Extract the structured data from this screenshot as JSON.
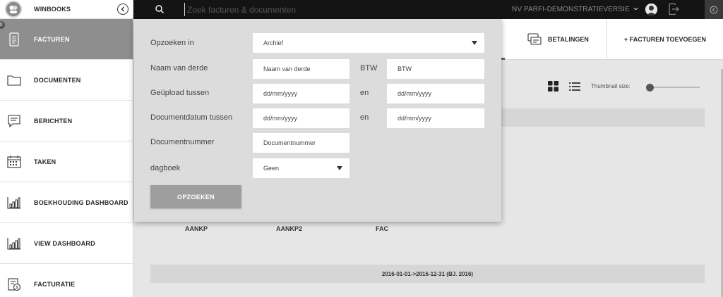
{
  "brand": {
    "name": "WINBOOKS"
  },
  "sidebar": {
    "items": [
      {
        "label": "FACTUREN",
        "icon": "document-icon",
        "active": true
      },
      {
        "label": "DOCUMENTEN",
        "icon": "folder-icon"
      },
      {
        "label": "BERICHTEN",
        "icon": "message-icon"
      },
      {
        "label": "TAKEN",
        "icon": "calendar-icon"
      },
      {
        "label": "BOEKHOUDING DASHBOARD",
        "icon": "bar-chart-icon"
      },
      {
        "label": "VIEW DASHBOARD",
        "icon": "bar-chart-icon"
      },
      {
        "label": "FACTURATIE",
        "icon": "invoice-icon"
      }
    ],
    "badge": "0"
  },
  "topbar": {
    "search_placeholder": "Zoek facturen & documenten",
    "company": "NV PARFI-DEMONSTRATIEVERSIE"
  },
  "tabs": {
    "payments": "BETALINGEN",
    "add_invoices": "+ FACTUREN TOEVOEGEN"
  },
  "view": {
    "thumbnail_label": "Thumbnail size:",
    "thumbnail_level": 0
  },
  "journals": [
    "AANKP",
    "AANKP2",
    "FAC"
  ],
  "period": "2016-01-01->2016-12-31 (BJ. 2016)",
  "search_panel": {
    "search_in_label": "Opzoeken in",
    "search_in_value": "Archief",
    "third_party_label": "Naam van derde",
    "third_party_placeholder": "Naam van derde",
    "vat_label": "BTW",
    "vat_placeholder": "BTW",
    "uploaded_label": "Geüpload tussen",
    "date_placeholder": "dd/mm/yyyy",
    "and_label": "en",
    "docdate_label": "Documentdatum tussen",
    "docnumber_label": "Documentnummer",
    "docnumber_placeholder": "Documentnummer",
    "journal_label": "dagboek",
    "journal_value": "Geen",
    "search_button": "OPZOEKEN"
  },
  "colors": {
    "topbar": "#141414",
    "active_nav": "#8e8e8e",
    "panel": "#dcdcdc",
    "button": "#9e9e9e"
  }
}
